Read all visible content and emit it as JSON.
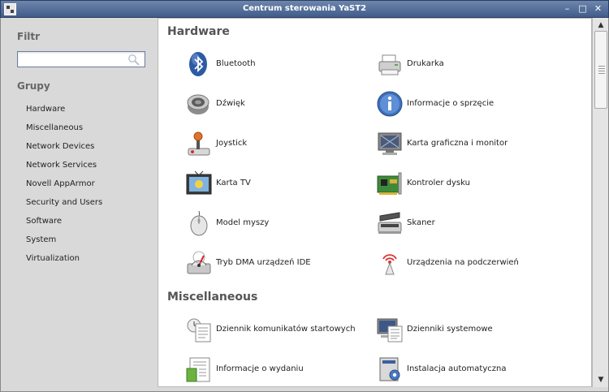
{
  "window": {
    "title": "Centrum sterowania YaST2",
    "minimize": "–",
    "maximize": "□",
    "close": "✕"
  },
  "sidebar": {
    "filter_label": "Filtr",
    "search": {
      "value": "",
      "placeholder": ""
    },
    "groups_label": "Grupy",
    "groups": [
      "Hardware",
      "Miscellaneous",
      "Network Devices",
      "Network Services",
      "Novell AppArmor",
      "Security and Users",
      "Software",
      "System",
      "Virtualization"
    ]
  },
  "sections": [
    {
      "title": "Hardware",
      "items": [
        {
          "label": "Bluetooth",
          "icon": "bluetooth-icon"
        },
        {
          "label": "Drukarka",
          "icon": "printer-icon"
        },
        {
          "label": "Dźwięk",
          "icon": "sound-icon"
        },
        {
          "label": "Informacje o sprzęcie",
          "icon": "info-icon"
        },
        {
          "label": "Joystick",
          "icon": "joystick-icon"
        },
        {
          "label": "Karta graficzna i monitor",
          "icon": "monitor-icon"
        },
        {
          "label": "Karta TV",
          "icon": "tv-card-icon"
        },
        {
          "label": "Kontroler dysku",
          "icon": "disk-controller-icon"
        },
        {
          "label": "Model myszy",
          "icon": "mouse-icon"
        },
        {
          "label": "Skaner",
          "icon": "scanner-icon"
        },
        {
          "label": "Tryb DMA urządzeń IDE",
          "icon": "ide-dma-icon"
        },
        {
          "label": "Urządzenia na podczerwień",
          "icon": "infrared-icon"
        }
      ]
    },
    {
      "title": "Miscellaneous",
      "items": [
        {
          "label": "Dziennik komunikatów startowych",
          "icon": "boot-log-icon"
        },
        {
          "label": "Dzienniki systemowe",
          "icon": "system-log-icon"
        },
        {
          "label": "Informacje o wydaniu",
          "icon": "release-notes-icon"
        },
        {
          "label": "Instalacja automatyczna",
          "icon": "autoinstall-icon"
        }
      ]
    }
  ],
  "colors": {
    "titlebar": "#4f6a96",
    "sidebar": "#d9d9d9",
    "panel": "#ffffff",
    "heading": "#555555"
  }
}
